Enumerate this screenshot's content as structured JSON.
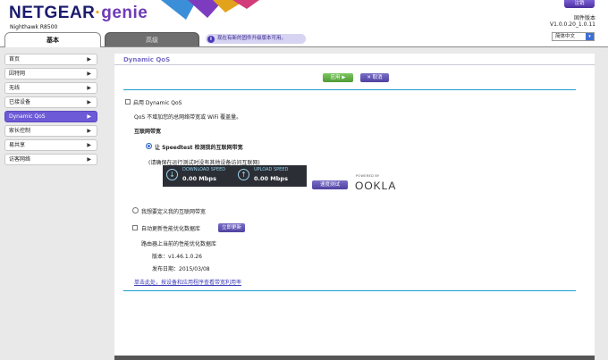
{
  "header": {
    "logo_main": "NETGEAR",
    "logo_genie": "genie",
    "model": "Nighthawk R8500",
    "logout_label": "注销",
    "firmware_label": "固件版本",
    "firmware_version": "V1.0.0.20_1.0.11",
    "language": "简体中文"
  },
  "tabs": {
    "basic": "基本",
    "advanced": "高级",
    "notice": "现在有新的固件升级版本可用。"
  },
  "sidebar": {
    "items": [
      {
        "label": "首页"
      },
      {
        "label": "因特网"
      },
      {
        "label": "无线"
      },
      {
        "label": "已接设备"
      },
      {
        "label": "Dynamic QoS"
      },
      {
        "label": "家长控制"
      },
      {
        "label": "易共享"
      },
      {
        "label": "访客网络"
      }
    ]
  },
  "main": {
    "title": "Dynamic QoS",
    "apply_label": "应用 ▶",
    "cancel_label": "✕ 取消",
    "enable_qos_label": "启用 Dynamic QoS",
    "qos_desc": "QoS 不增加您的总网络带宽或 WiFi 覆盖量。",
    "bandwidth_heading": "互联网带宽",
    "speedtest_option": "让 Speedtest 检测我的互联网带宽",
    "speedtest_note": "(请确保在运行测试时没有其他设备访问互联网)",
    "download_label": "DOWNLOAD SPEED",
    "download_value": "0.00 Mbps",
    "upload_label": "UPLOAD SPEED",
    "upload_value": "0.00 Mbps",
    "speed_test_button": "速度测试",
    "ookla_powered": "POWERED BY",
    "ookla_name": "OOKLA",
    "custom_bandwidth_option": "我想要定义我的互联网带宽",
    "auto_update_label": "自动更新性能优化数据库",
    "update_now_button": "立即更新",
    "db_desc": "路由器上当前的性能优化数据库",
    "version_label": "版本：v1.46.1.0.26",
    "release_date_label": "发布日期：2015/03/08",
    "usage_link": "单击此处，按设备和应用程序查看带宽利用率"
  },
  "colors": {
    "accent_purple": "#6d5ad6",
    "rule_blue": "#1a9ed2",
    "apply_green": "#5aa83e"
  }
}
